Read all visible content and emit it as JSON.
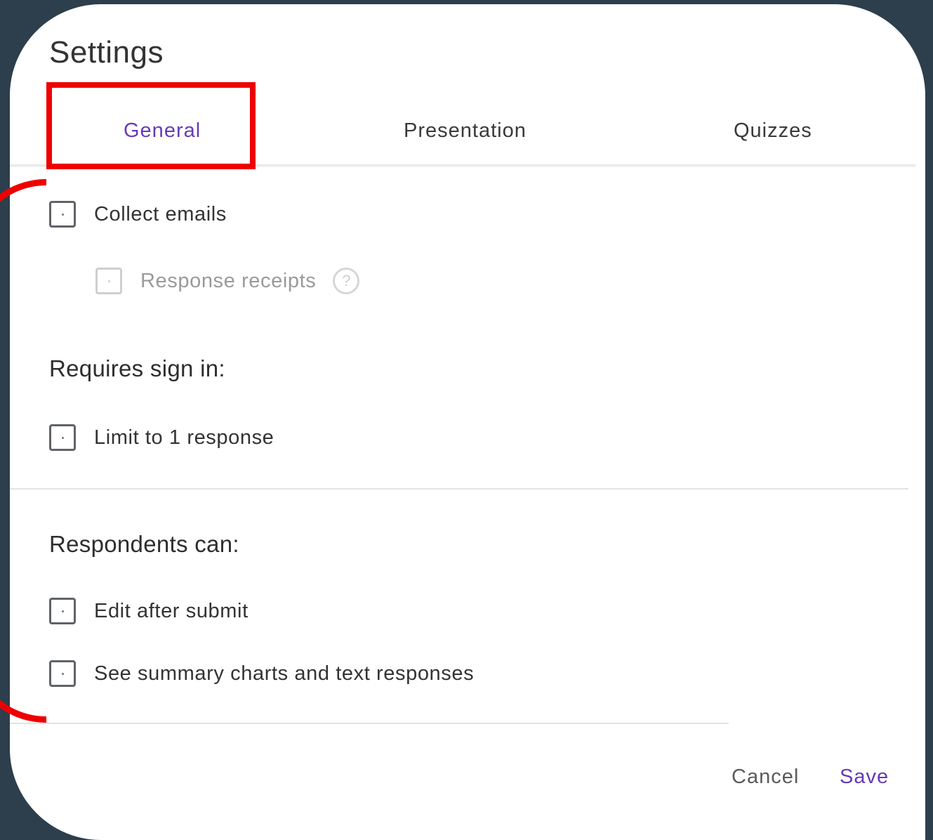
{
  "dialog": {
    "title": "Settings"
  },
  "tabs": [
    {
      "label": "General",
      "active": true
    },
    {
      "label": "Presentation",
      "active": false
    },
    {
      "label": "Quizzes",
      "active": false
    }
  ],
  "general": {
    "collect_emails": {
      "label": "Collect emails",
      "checked": false
    },
    "response_receipts": {
      "label": "Response receipts",
      "checked": false,
      "disabled": true,
      "help_icon": "help-circle-icon",
      "help_glyph": "?"
    },
    "requires_sign_in": {
      "heading": "Requires sign in:",
      "limit_one": {
        "label": "Limit to 1 response",
        "checked": false
      }
    },
    "respondents_can": {
      "heading": "Respondents can:",
      "edit_after_submit": {
        "label": "Edit after submit",
        "checked": false
      },
      "see_summary": {
        "label": "See summary charts and text responses",
        "checked": false
      }
    }
  },
  "footer": {
    "cancel_label": "Cancel",
    "save_label": "Save"
  },
  "annotations": {
    "highlight_color": "#ee0000"
  },
  "colors": {
    "accent": "#673ab7",
    "background": "#2d3e4c"
  }
}
